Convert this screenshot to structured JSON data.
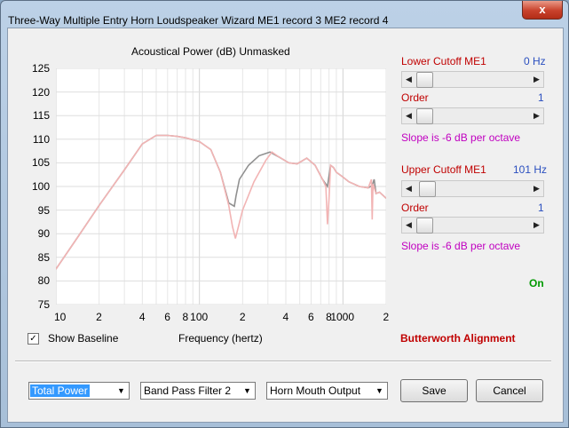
{
  "window": {
    "title": "Three-Way Multiple Entry Horn Loudspeaker Wizard    ME1 record 3    ME2 record 4",
    "close_symbol": "x"
  },
  "chart": {
    "title": "Acoustical Power (dB)    Unmasked",
    "xlabel": "Frequency (hertz)",
    "show_baseline_label": "Show Baseline",
    "checkbox_mark": "✓"
  },
  "chart_data": {
    "type": "line",
    "title": "Acoustical Power (dB)    Unmasked",
    "xlabel": "Frequency (hertz)",
    "ylabel": "",
    "x_scale": "log",
    "xlim": [
      10,
      2000
    ],
    "ylim": [
      75,
      125
    ],
    "grid": true,
    "y_ticks": [
      125,
      120,
      115,
      110,
      105,
      100,
      95,
      90,
      85,
      80,
      75
    ],
    "x_ticks": [
      "10",
      "2",
      "4",
      "6",
      "8",
      "100",
      "2",
      "4",
      "6",
      "8",
      "1000",
      "2"
    ],
    "series": [
      {
        "color": "#909090",
        "x": [
          10,
          14,
          20,
          30,
          40,
          50,
          60,
          70,
          80,
          100,
          120,
          140,
          160,
          175,
          180,
          190,
          220,
          260,
          310,
          360,
          420,
          480,
          560,
          640,
          720,
          780,
          820,
          860,
          900,
          1000,
          1100,
          1300,
          1500,
          1600,
          1650,
          1700,
          1800,
          2000
        ],
        "y": [
          82.5,
          89,
          96,
          103.5,
          109,
          110.8,
          110.8,
          110.6,
          110.3,
          109.5,
          107.8,
          103,
          96.5,
          95.8,
          98,
          101.5,
          104.5,
          106.5,
          107.3,
          106.2,
          105,
          104.8,
          106,
          104.5,
          101.5,
          100,
          104.5,
          104,
          103,
          102,
          101,
          100,
          99.7,
          100.2,
          101.5,
          98.5,
          98.8,
          97.5
        ]
      },
      {
        "color": "#f2b4b4",
        "x": [
          10,
          14,
          20,
          30,
          40,
          50,
          60,
          70,
          80,
          100,
          120,
          140,
          160,
          170,
          178,
          185,
          200,
          240,
          290,
          320,
          360,
          420,
          480,
          560,
          640,
          720,
          760,
          780,
          800,
          820,
          860,
          900,
          1000,
          1100,
          1300,
          1500,
          1580,
          1600,
          1620,
          1700,
          1800,
          2000
        ],
        "y": [
          82.5,
          89,
          96,
          103.5,
          109,
          110.8,
          110.8,
          110.6,
          110.3,
          109.5,
          107.8,
          103,
          96,
          91.5,
          89,
          91,
          95,
          101,
          105.5,
          107.3,
          106.2,
          105,
          104.8,
          106,
          104.5,
          101.5,
          100,
          92,
          97.5,
          104.5,
          104,
          103,
          102,
          101,
          100,
          99.7,
          101.5,
          93,
          100.5,
          98.5,
          98.8,
          97.5
        ]
      }
    ]
  },
  "controls": {
    "lower_cutoff": {
      "label": "Lower Cutoff  ME1",
      "value": "0 Hz"
    },
    "lower_order": {
      "label": "Order",
      "value": "1"
    },
    "lower_slope": "Slope is -6 dB per octave",
    "upper_cutoff": {
      "label": "Upper Cutoff  ME1",
      "value": "101 Hz"
    },
    "upper_order": {
      "label": "Order",
      "value": "1"
    },
    "upper_slope": "Slope is -6 dB per octave",
    "status": "On",
    "alignment": "Butterworth Alignment",
    "arrow_left": "◀",
    "arrow_right": "▶",
    "arrow_down": "▼"
  },
  "footer": {
    "power_select": "Total Power",
    "filter_select": "Band Pass Filter 2",
    "output_select": "Horn Mouth Output",
    "save_label": "Save",
    "cancel_label": "Cancel"
  }
}
